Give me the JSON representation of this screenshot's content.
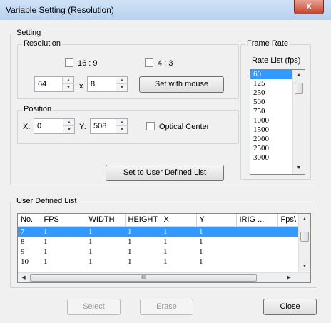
{
  "window": {
    "title": "Variable Setting (Resolution)",
    "close_glyph": "X"
  },
  "setting": {
    "group_label": "Setting",
    "resolution": {
      "group_label": "Resolution",
      "aspect_16_9": "16 : 9",
      "aspect_4_3": "4 : 3",
      "width_value": "64",
      "height_value": "8",
      "times": "x",
      "set_with_mouse_label": "Set with mouse"
    },
    "position": {
      "group_label": "Position",
      "x_label": "X:",
      "x_value": "0",
      "y_label": "Y:",
      "y_value": "508",
      "optical_center_label": "Optical Center"
    },
    "set_user_list_label": "Set to User Defined List",
    "frame_rate": {
      "group_label": "Frame Rate",
      "list_label": "Rate List (fps)",
      "rates": [
        "60",
        "125",
        "250",
        "500",
        "750",
        "1000",
        "1500",
        "2000",
        "2500",
        "3000"
      ],
      "selected": "60"
    }
  },
  "user_list": {
    "group_label": "User Defined List",
    "columns": [
      "No.",
      "FPS",
      "WIDTH",
      "HEIGHT",
      "X",
      "Y",
      "IRIG ...",
      "Fps\\"
    ],
    "rows": [
      [
        "7",
        "1",
        "1",
        "1",
        "1",
        "1"
      ],
      [
        "8",
        "1",
        "1",
        "1",
        "1",
        "1"
      ],
      [
        "9",
        "1",
        "1",
        "1",
        "1",
        "1"
      ],
      [
        "10",
        "1",
        "1",
        "1",
        "1",
        "1"
      ]
    ],
    "scroll_thumb_glyph": "III"
  },
  "buttons": {
    "select": "Select",
    "erase": "Erase",
    "close": "Close"
  },
  "icons": {
    "spin_up": "up-arrow-icon",
    "spin_down": "down-arrow-icon"
  }
}
